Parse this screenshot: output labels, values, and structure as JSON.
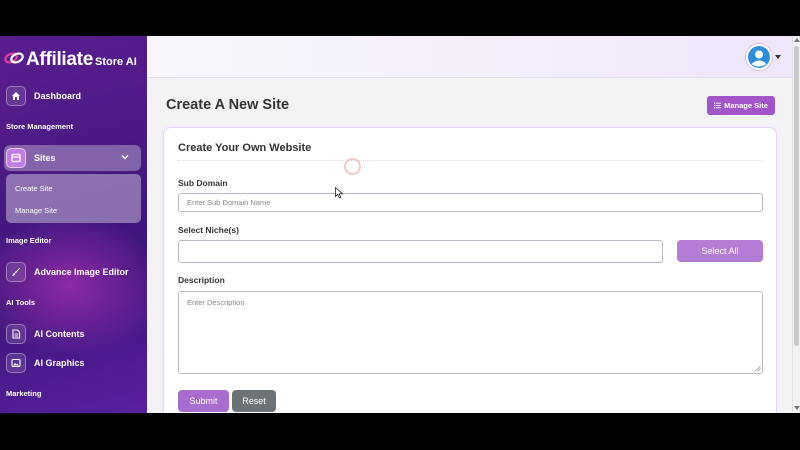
{
  "brand": {
    "name": "Affiliate",
    "suffix": "Store AI"
  },
  "sidebar": {
    "dashboard": "Dashboard",
    "sections": {
      "store_management": "Store Management",
      "image_editor": "Image Editor",
      "ai_tools": "AI Tools",
      "marketing": "Marketing"
    },
    "sites": "Sites",
    "sites_submenu": [
      "Create Site",
      "Manage Site"
    ],
    "advance_image_editor": "Advance Image Editor",
    "ai_contents": "AI Contents",
    "ai_graphics": "AI Graphics"
  },
  "page": {
    "title": "Create A New Site",
    "manage_site_button": "Manage Site"
  },
  "form": {
    "card_title": "Create Your Own Website",
    "subdomain": {
      "label": "Sub Domain",
      "placeholder": "Enter Sub Domain Name",
      "value": ""
    },
    "niches": {
      "label": "Select Niche(s)",
      "value": "",
      "select_all_button": "Select All"
    },
    "description": {
      "label": "Description",
      "placeholder": "Enter Description",
      "value": ""
    },
    "submit_button": "Submit",
    "reset_button": "Reset"
  },
  "colors": {
    "accent": "#a254c9",
    "sidebar_top": "#5a1c8f",
    "sidebar_bottom": "#3a1678",
    "reset_gray": "#6b7377"
  }
}
